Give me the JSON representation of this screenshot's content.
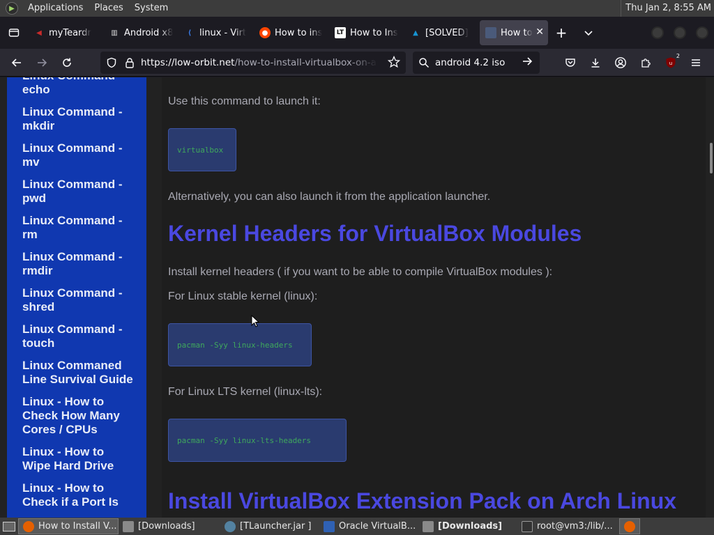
{
  "top_panel": {
    "menus": [
      "Applications",
      "Places",
      "System"
    ],
    "clock": "Thu Jan  2,  8:55 AM"
  },
  "tabs": [
    {
      "title": "myTeardr",
      "icon": "teardrop-icon",
      "color": "#c92b2b"
    },
    {
      "title": "Android x8",
      "icon": "archive-icon",
      "color": "#d9d9d9"
    },
    {
      "title": "linux - Virt",
      "icon": "bracket-icon",
      "color": "#3b82f6"
    },
    {
      "title": "How to ins",
      "icon": "reddit-icon",
      "color": "#ff4500"
    },
    {
      "title": "How to Ins",
      "icon": "lt-icon",
      "color": "#ffffff"
    },
    {
      "title": "[SOLVED]",
      "icon": "arch-icon",
      "color": "#1793d1"
    },
    {
      "title": "How to",
      "icon": "page-icon",
      "color": "#4a5a7a"
    }
  ],
  "nav": {
    "url_host": "https://low-orbit.net",
    "url_path": "/how-to-install-virtualbox-on-arch-linux",
    "search_value": "android 4.2 iso",
    "notification_badge": "2"
  },
  "sidebar": {
    "items": [
      "Linux Command - echo",
      "Linux Command - mkdir",
      "Linux Command - mv",
      "Linux Command - pwd",
      "Linux Command - rm",
      "Linux Command - rmdir",
      "Linux Command - shred",
      "Linux Command - touch",
      "Linux Commaned Line Survival Guide",
      "Linux - How to Check How Many Cores / CPUs",
      "Linux - How to Wipe Hard Drive",
      "Linux - How to Check if a Port Is"
    ]
  },
  "content": {
    "p_launch": "Use this command to launch it:",
    "code_launch": "virtualbox",
    "p_alt": "Alternatively, you can also launch it from the application launcher.",
    "h_kernel": "Kernel Headers for VirtualBox Modules",
    "p_install": "Install kernel headers ( if you want to be able to compile VirtualBox modules ):",
    "p_stable": "For Linux stable kernel (linux):",
    "code_stable": "pacman -Syy linux-headers",
    "p_lts": "For Linux LTS kernel (linux-lts):",
    "code_lts": "pacman -Syy linux-lts-headers",
    "h_ext": "Install VirtualBox Extension Pack on Arch Linux"
  },
  "taskbar": {
    "tasks": [
      {
        "label": "How to Install V...",
        "icon": "firefox-icon",
        "color": "#e66000"
      },
      {
        "label": "[Downloads]",
        "icon": "folder-icon",
        "color": "#8a8a8a"
      },
      {
        "label": "[TLauncher.jar ]",
        "icon": "java-icon",
        "color": "#5382a1"
      },
      {
        "label": "Oracle VirtualB...",
        "icon": "virtualbox-icon",
        "color": "#2f61b4"
      },
      {
        "label": "[Downloads]",
        "icon": "folder-icon",
        "color": "#8a8a8a"
      },
      {
        "label": "root@vm3:/lib/...",
        "icon": "terminal-icon",
        "color": "#333333"
      }
    ]
  }
}
